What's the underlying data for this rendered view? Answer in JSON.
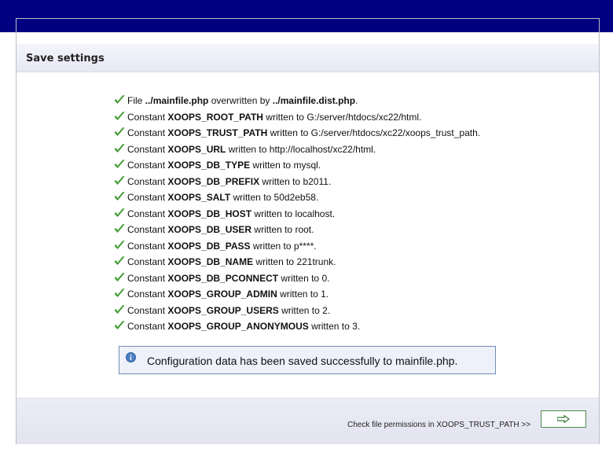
{
  "page": {
    "title": "Save settings"
  },
  "log": [
    {
      "prefix": "File",
      "name": "../mainfile.php",
      "middle": "overwritten by",
      "value": "../mainfile.dist.php",
      "value_bold": true,
      "suffix": "."
    },
    {
      "prefix": "Constant",
      "name": "XOOPS_ROOT_PATH",
      "middle": "written to",
      "value": "G:/server/htdocs/xc22/html",
      "value_bold": false,
      "suffix": "."
    },
    {
      "prefix": "Constant",
      "name": "XOOPS_TRUST_PATH",
      "middle": "written to",
      "value": "G:/server/htdocs/xc22/xoops_trust_path",
      "value_bold": false,
      "suffix": "."
    },
    {
      "prefix": "Constant",
      "name": "XOOPS_URL",
      "middle": "written to",
      "value": "http://localhost/xc22/html",
      "value_bold": false,
      "suffix": "."
    },
    {
      "prefix": "Constant",
      "name": "XOOPS_DB_TYPE",
      "middle": "written to",
      "value": "mysql",
      "value_bold": false,
      "suffix": "."
    },
    {
      "prefix": "Constant",
      "name": "XOOPS_DB_PREFIX",
      "middle": "written to",
      "value": "b2011",
      "value_bold": false,
      "suffix": "."
    },
    {
      "prefix": "Constant",
      "name": "XOOPS_SALT",
      "middle": "written to",
      "value": "50d2eb58",
      "value_bold": false,
      "suffix": "."
    },
    {
      "prefix": "Constant",
      "name": "XOOPS_DB_HOST",
      "middle": "written to",
      "value": "localhost",
      "value_bold": false,
      "suffix": "."
    },
    {
      "prefix": "Constant",
      "name": "XOOPS_DB_USER",
      "middle": "written to",
      "value": "root",
      "value_bold": false,
      "suffix": "."
    },
    {
      "prefix": "Constant",
      "name": "XOOPS_DB_PASS",
      "middle": "written to",
      "value": "p****",
      "value_bold": false,
      "suffix": "."
    },
    {
      "prefix": "Constant",
      "name": "XOOPS_DB_NAME",
      "middle": "written to",
      "value": "221trunk",
      "value_bold": false,
      "suffix": "."
    },
    {
      "prefix": "Constant",
      "name": "XOOPS_DB_PCONNECT",
      "middle": "written to",
      "value": "0",
      "value_bold": false,
      "suffix": "."
    },
    {
      "prefix": "Constant",
      "name": "XOOPS_GROUP_ADMIN",
      "middle": "written to",
      "value": "1",
      "value_bold": false,
      "suffix": "."
    },
    {
      "prefix": "Constant",
      "name": "XOOPS_GROUP_USERS",
      "middle": "written to",
      "value": "2",
      "value_bold": false,
      "suffix": "."
    },
    {
      "prefix": "Constant",
      "name": "XOOPS_GROUP_ANONYMOUS",
      "middle": "written to",
      "value": "3",
      "value_bold": false,
      "suffix": "."
    }
  ],
  "message": {
    "text": "Configuration data has been saved successfully to mainfile.php.",
    "icon": "info-icon"
  },
  "footer": {
    "next_label": "Check file permissions in XOOPS_TRUST_PATH >>",
    "next_button_icon": "arrow-right-icon"
  },
  "colors": {
    "top_band": "#000080",
    "check": "#3c9a2c",
    "button_border": "#4a8a4a",
    "message_border": "#6f8fb0"
  },
  "icons": {
    "log_item": "check-icon"
  }
}
